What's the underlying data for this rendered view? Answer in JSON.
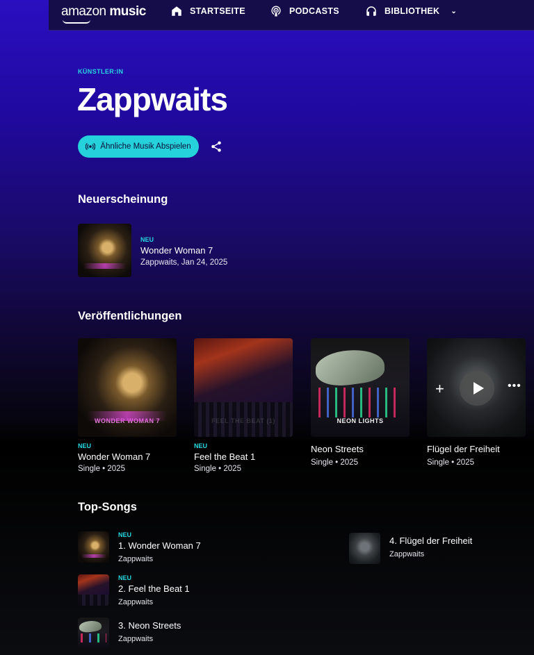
{
  "nav": {
    "logo_brand": "amazon",
    "logo_product": "music",
    "home": "STARTSEITE",
    "podcasts": "PODCASTS",
    "library": "BIBLIOTHEK",
    "library_chevron": "⌄"
  },
  "artist": {
    "eyebrow": "KÜNSTLER:IN",
    "name": "Zappwaits",
    "play_similar": "Ähnliche Musik Abspielen"
  },
  "new_release": {
    "section_title": "Neuerscheinung",
    "tag": "NEU",
    "title": "Wonder Woman 7",
    "subtitle": "Zappwaits, Jan 24, 2025"
  },
  "releases": {
    "section_title": "Veröffentlichungen",
    "items": [
      {
        "tag": "NEU",
        "title": "Wonder Woman 7",
        "subtitle": "Single • 2025",
        "art_text": "WONDER WOMAN 7"
      },
      {
        "tag": "NEU",
        "title": "Feel the Beat 1",
        "subtitle": "Single • 2025",
        "art_text": "FEEL THE BEAT (1)"
      },
      {
        "tag": "",
        "title": "Neon Streets",
        "subtitle": "Single • 2025",
        "art_text": "NEON LIGHTS"
      },
      {
        "tag": "",
        "title": "Flügel der Freiheit",
        "subtitle": "Single • 2025",
        "art_text": ""
      }
    ],
    "hover_controls": {
      "add": "+",
      "more": "•••"
    }
  },
  "top_songs": {
    "section_title": "Top-Songs",
    "items": [
      {
        "tag": "NEU",
        "title": "1. Wonder Woman 7",
        "artist": "Zappwaits"
      },
      {
        "tag": "NEU",
        "title": "2. Feel the Beat 1",
        "artist": "Zappwaits"
      },
      {
        "tag": "",
        "title": "3. Neon Streets",
        "artist": "Zappwaits"
      },
      {
        "tag": "",
        "title": "4. Flügel der Freiheit",
        "artist": "Zappwaits"
      }
    ]
  },
  "icons": {
    "home": "home-icon",
    "podcasts": "podcast-icon",
    "library": "headphones-icon",
    "broadcast": "broadcast-icon",
    "share": "share-icon"
  },
  "colors": {
    "accent": "#25d1da",
    "new_tag": "#28d7e0",
    "header_bg": "#150c4a",
    "gradient_top": "#2a0fc0",
    "bottom_bg": "#0b0c10"
  }
}
